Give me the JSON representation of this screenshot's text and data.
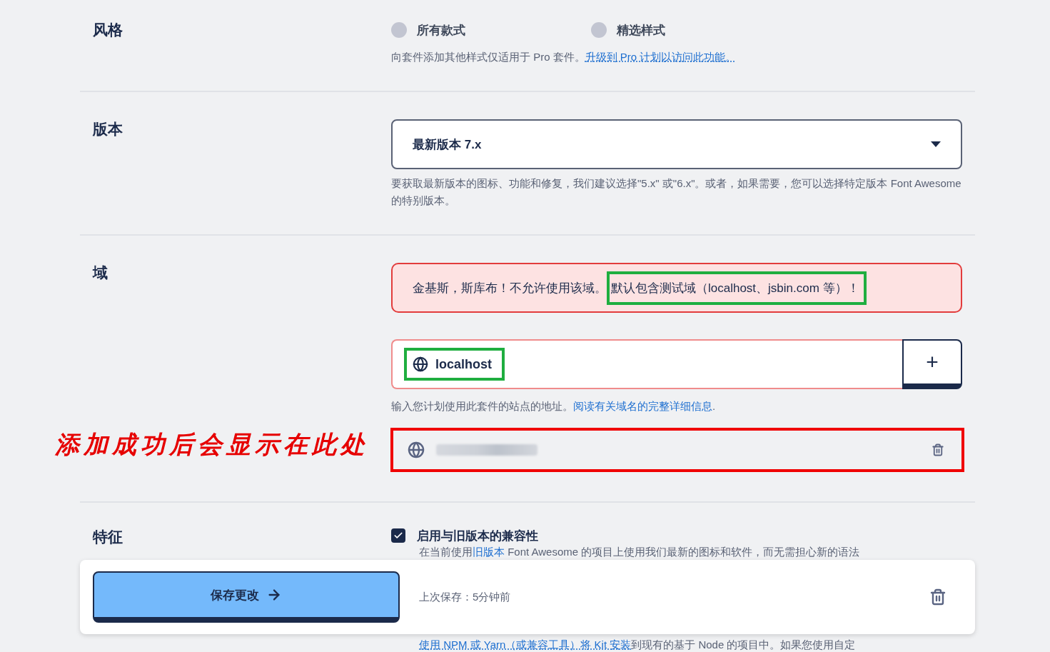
{
  "style": {
    "label": "风格",
    "options": [
      {
        "label": "所有款式",
        "selected": false
      },
      {
        "label": "精选样式",
        "selected": false
      }
    ],
    "help": "向套件添加其他样式仅适用于 Pro 套件。",
    "help_link": "升级到 Pro 计划以访问此功能。"
  },
  "version": {
    "label": "版本",
    "value": "最新版本 7.x",
    "help": "要获取最新版本的图标、功能和修复，我们建议选择\"5.x\" 或\"6.x\"。或者，如果需要，您可以选择特定版本 Font Awesome 的特别版本。"
  },
  "domain": {
    "label": "域",
    "alert": "金基斯，斯库布！不允许使用该域。",
    "alert_note": "默认包含测试域（localhost、jsbin.com 等）！",
    "input_value": "localhost",
    "add_button": "+",
    "help": "输入您计划使用此套件的站点的地址。",
    "help_link": "阅读有关域名的完整详细信息",
    "help_end": ".",
    "added": [
      {
        "kind": "blurred"
      }
    ],
    "annotation": "添加成功后会显示在此处"
  },
  "features": {
    "label": "特征",
    "checked": true,
    "option": "启用与旧版本的兼容性",
    "desc_start": "在当前使用",
    "desc_link": "旧版本",
    "desc_rest": " Font Awesome 的项目上使用我们最新的图标和软件，而无需担心新的语法",
    "next_link": "使用 NPM 或 Yarn（或兼容工具）将 Kit 安装",
    "next_rest": "到现有的基于 Node 的项目中。如果您使用自定"
  },
  "footer": {
    "save_button": "保存更改",
    "last_saved": "上次保存：5分钟前"
  }
}
